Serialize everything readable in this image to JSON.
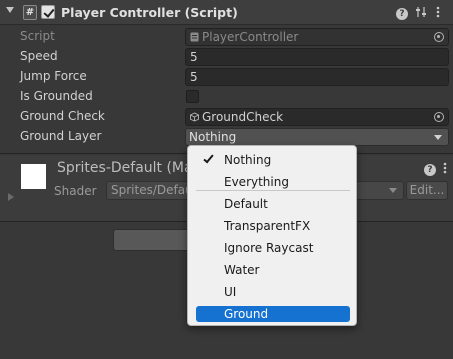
{
  "component": {
    "title": "Player Controller (Script)",
    "script_icon": "#",
    "enabled": true
  },
  "fields": {
    "script": {
      "label": "Script",
      "value": "PlayerController"
    },
    "speed": {
      "label": "Speed",
      "value": "5"
    },
    "jump_force": {
      "label": "Jump Force",
      "value": "5"
    },
    "is_grounded": {
      "label": "Is Grounded",
      "checked": false
    },
    "ground_check": {
      "label": "Ground Check",
      "value": "GroundCheck"
    },
    "ground_layer": {
      "label": "Ground Layer",
      "value": "Nothing"
    }
  },
  "material": {
    "name": "Sprites-Default (Mat",
    "shader_label": "Shader",
    "shader_value": "Sprites/Defau",
    "edit_label": "Edit..."
  },
  "layer_menu": {
    "items": [
      {
        "label": "Nothing",
        "checked": true,
        "selected": false
      },
      {
        "label": "Everything",
        "checked": false,
        "selected": false
      },
      {
        "label": "Default",
        "checked": false,
        "selected": false
      },
      {
        "label": "TransparentFX",
        "checked": false,
        "selected": false
      },
      {
        "label": "Ignore Raycast",
        "checked": false,
        "selected": false
      },
      {
        "label": "Water",
        "checked": false,
        "selected": false
      },
      {
        "label": "UI",
        "checked": false,
        "selected": false
      },
      {
        "label": "Ground",
        "checked": false,
        "selected": true
      }
    ]
  },
  "icons": {
    "help": "help-icon",
    "presets": "presets-icon",
    "more": "more-icon",
    "picker": "object-picker-icon"
  },
  "colors": {
    "background": "#383838",
    "selection": "#1572d1",
    "menu_bg": "#f0f0f0"
  }
}
